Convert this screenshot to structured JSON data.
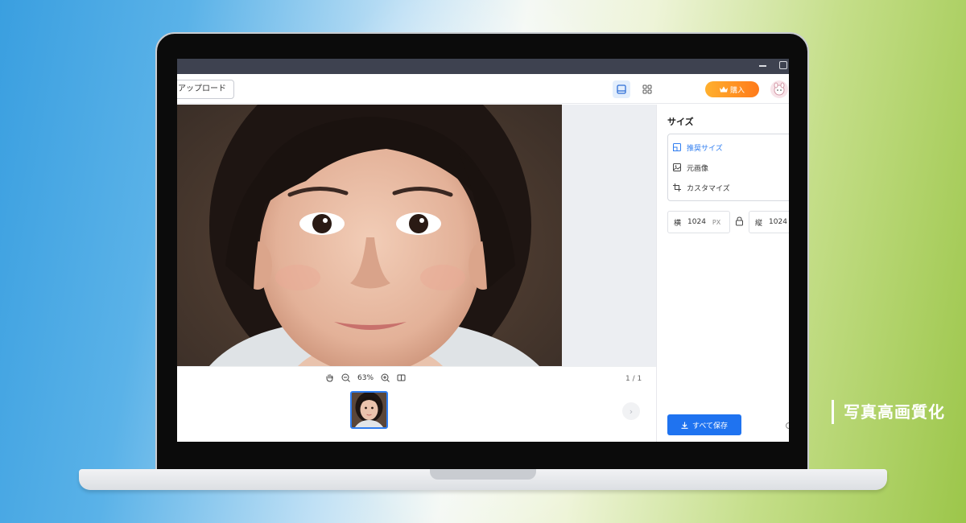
{
  "toolbar": {
    "upload_label": "アップロード",
    "buy_label": "購入",
    "buy_icon": "crown-icon",
    "view_single_icon": "single-view-icon",
    "view_grid_icon": "grid-view-icon",
    "avatar_icon": "avatar-icon"
  },
  "viewer": {
    "zoom_level": "63%",
    "page_count": "1 / 1",
    "tools": [
      "hand-icon",
      "zoom-out-icon",
      "zoom-in-icon",
      "compare-icon"
    ]
  },
  "panel": {
    "title": "サイズ",
    "options": [
      {
        "label": "推奨サイズ",
        "icon": "recommended-size-icon",
        "active": true
      },
      {
        "label": "元画像",
        "icon": "original-image-icon",
        "active": false
      },
      {
        "label": "カスタマイズ",
        "icon": "crop-icon",
        "active": false
      }
    ],
    "width_label": "横",
    "width_value": "1024",
    "width_unit": "PX",
    "height_label": "縦",
    "height_value": "1024",
    "save_label": "すべて保存",
    "save_icon": "download-icon"
  },
  "caption": "写真高画質化",
  "colors": {
    "accent": "#1f73f0",
    "buy_start": "#ffb02e",
    "buy_end": "#ff7a1a",
    "titlebar": "#3e4250"
  }
}
